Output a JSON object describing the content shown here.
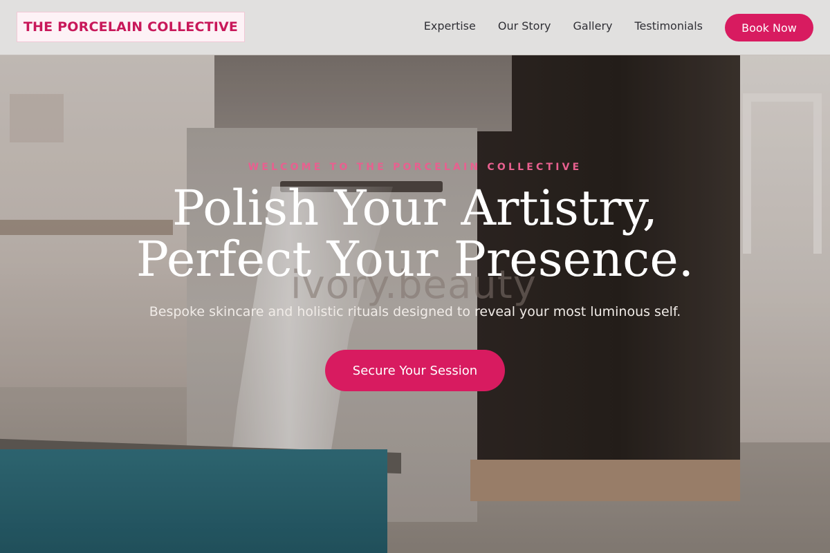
{
  "brand": {
    "name": "THE PORCELAIN COLLECTIVE",
    "accent": "#d81b60"
  },
  "nav": {
    "links": [
      {
        "label": "Expertise"
      },
      {
        "label": "Our Story"
      },
      {
        "label": "Gallery"
      },
      {
        "label": "Testimonials"
      }
    ],
    "cta_label": "Book Now"
  },
  "hero": {
    "eyebrow": "WELCOME TO THE PORCELAIN COLLECTIVE",
    "headline_line1": "Polish Your Artistry,",
    "headline_line2": "Perfect Your Presence.",
    "subheadline": "Bespoke skincare and holistic rituals designed to reveal your most luminous self.",
    "cta_label": "Secure Your Session",
    "background_watermark": "ivory.beauty"
  }
}
